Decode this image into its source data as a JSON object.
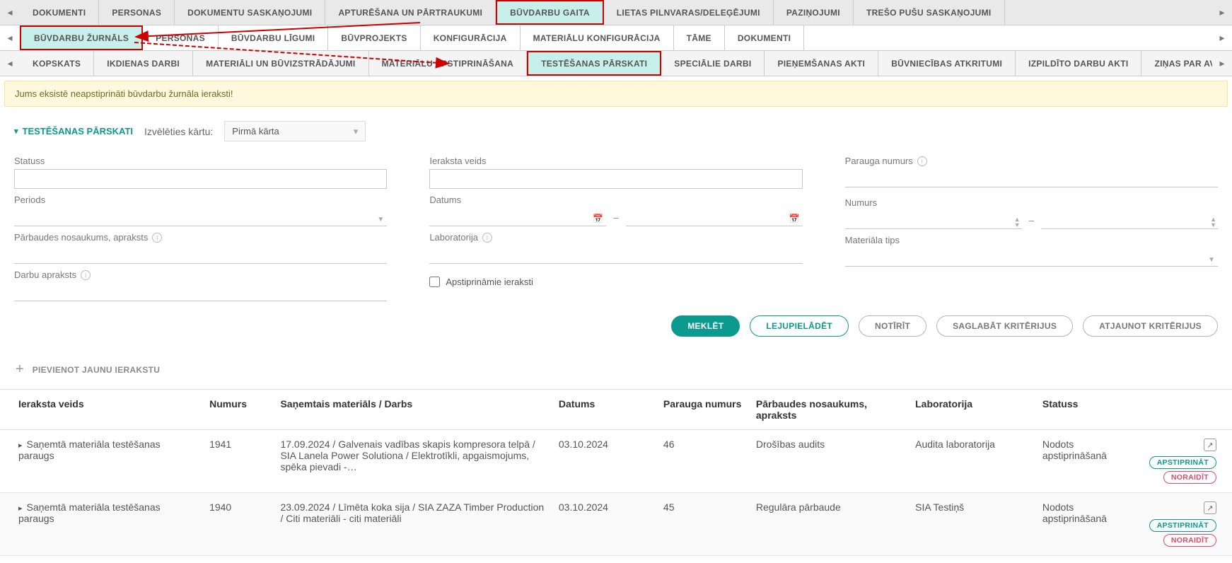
{
  "tabs_level1": [
    {
      "label": "DOKUMENTI"
    },
    {
      "label": "PERSONAS"
    },
    {
      "label": "DOKUMENTU SASKAŅOJUMI"
    },
    {
      "label": "APTURĒŠANA UN PĀRTRAUKUMI"
    },
    {
      "label": "BŪVDARBU GAITA",
      "highlighted": true
    },
    {
      "label": "LIETAS PILNVARAS/DELEĢĒJUMI"
    },
    {
      "label": "PAZIŅOJUMI"
    },
    {
      "label": "TREŠO PUŠU SASKAŅOJUMI"
    }
  ],
  "tabs_level2": [
    {
      "label": "BŪVDARBU ŽURNĀLS",
      "highlighted": true
    },
    {
      "label": "PERSONAS"
    },
    {
      "label": "BŪVDARBU LĪGUMI"
    },
    {
      "label": "BŪVPROJEKTS"
    },
    {
      "label": "KONFIGURĀCIJA"
    },
    {
      "label": "MATERIĀLU KONFIGURĀCIJA"
    },
    {
      "label": "TĀME"
    },
    {
      "label": "DOKUMENTI"
    }
  ],
  "tabs_level3": [
    {
      "label": "KOPSKATS"
    },
    {
      "label": "IKDIENAS DARBI"
    },
    {
      "label": "MATERIĀLI UN BŪVIZSTRĀDĀJUMI"
    },
    {
      "label": "MATERIĀLU APSTIPRINĀŠANA"
    },
    {
      "label": "TESTĒŠANAS PĀRSKATI",
      "highlighted": true
    },
    {
      "label": "SPECIĀLIE DARBI"
    },
    {
      "label": "PIEŅEMŠANAS AKTI"
    },
    {
      "label": "BŪVNIECĪBAS ATKRITUMI"
    },
    {
      "label": "IZPILDĪTO DARBU AKTI"
    },
    {
      "label": "ZIŅAS PAR AVĀRIJU VAI NELAIMI"
    }
  ],
  "notice": "Jums eksistē neapstiprināti būvdarbu žurnāla ieraksti!",
  "section": {
    "title": "TESTĒŠANAS PĀRSKATI",
    "round_label": "Izvēlēties kārtu:",
    "round_value": "Pirmā kārta"
  },
  "filters": {
    "status": "Statuss",
    "period": "Periods",
    "check_name": "Pārbaudes nosaukums, apraksts",
    "work_desc": "Darbu apraksts",
    "entry_type": "Ieraksta veids",
    "date": "Datums",
    "laboratory": "Laboratorija",
    "approvable": "Apstiprināmie ieraksti",
    "sample_no": "Parauga numurs",
    "number": "Numurs",
    "material_type": "Materiāla tips",
    "range_sep": "–"
  },
  "buttons": {
    "search": "MEKLĒT",
    "download": "LEJUPIELĀDĒT",
    "clear": "NOTĪRĪT",
    "save_criteria": "SAGLABĀT KRITĒRIJUS",
    "restore_criteria": "ATJAUNOT KRITĒRIJUS",
    "add_new": "PIEVIENOT JAUNU IERAKSTU",
    "approve": "APSTIPRINĀT",
    "reject": "NORAIDĪT"
  },
  "table": {
    "headers": {
      "type": "Ieraksta veids",
      "number": "Numurs",
      "material": "Saņemtais materiāls / Darbs",
      "date": "Datums",
      "sample": "Parauga numurs",
      "check": "Pārbaudes nosaukums, apraksts",
      "lab": "Laboratorija",
      "status": "Statuss"
    },
    "rows": [
      {
        "type": "Saņemtā materiāla testēšanas paraugs",
        "number": "1941",
        "material": "17.09.2024 / Galvenais vadības skapis kompresora telpā / SIA Lanela Power Solutiona / Elektrotīkli, apgaismojums, spēka pievadi -…",
        "date": "03.10.2024",
        "sample": "46",
        "check": "Drošības audits",
        "lab": "Audita laboratorija",
        "status": "Nodots apstiprināšanā"
      },
      {
        "type": "Saņemtā materiāla testēšanas paraugs",
        "number": "1940",
        "material": "23.09.2024 / Līmēta koka sija / SIA ZAZA Timber Production / Citi materiāli - citi materiāli",
        "date": "03.10.2024",
        "sample": "45",
        "check": "Regulāra pārbaude",
        "lab": "SIA Testiņš",
        "status": "Nodots apstiprināšanā"
      }
    ]
  }
}
